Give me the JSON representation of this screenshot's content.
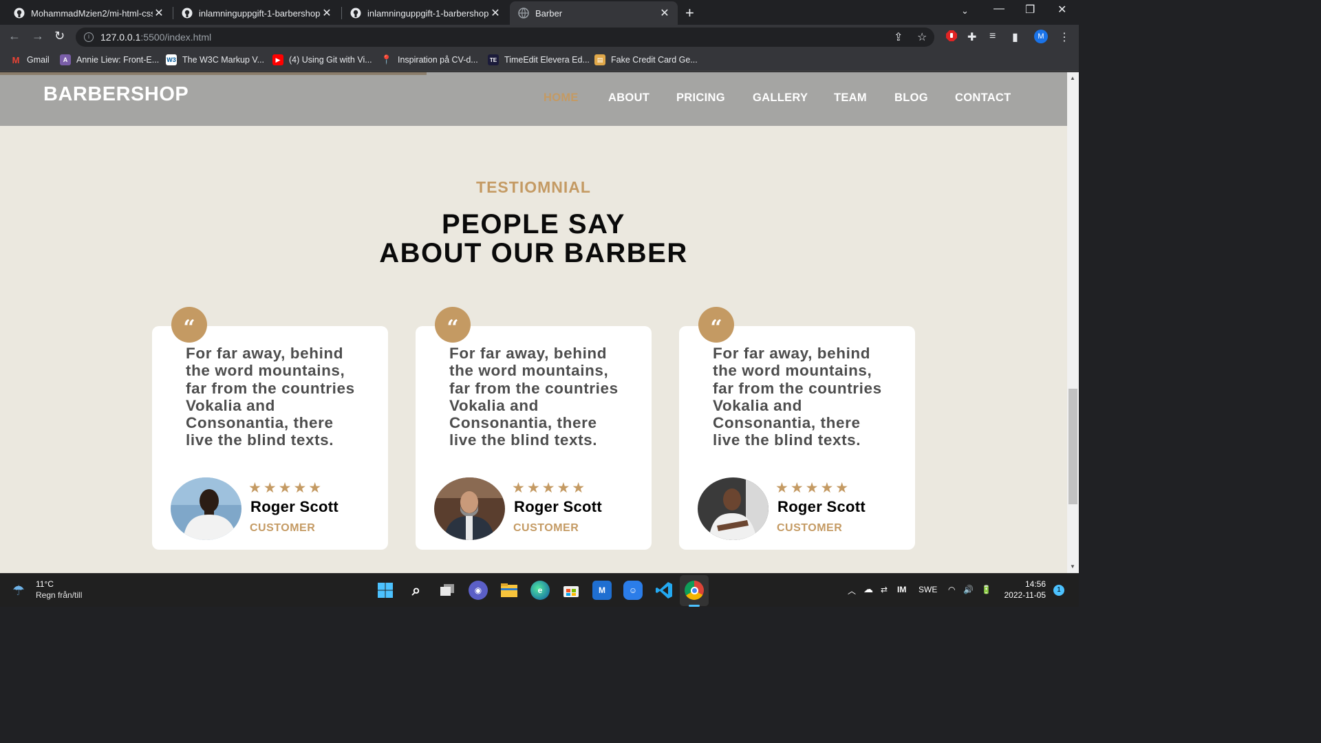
{
  "browser": {
    "tabs": [
      {
        "title": "MohammadMzien2/mi-html-css",
        "active": false
      },
      {
        "title": "inlamninguppgift-1-barbershop-",
        "active": false
      },
      {
        "title": "inlamninguppgift-1-barbershop-",
        "active": false
      },
      {
        "title": "Barber",
        "active": true
      }
    ],
    "url_host": "127.0.0.1",
    "url_path": ":5500/index.html",
    "profile_initial": "M",
    "bookmarks": [
      {
        "label": "Gmail"
      },
      {
        "label": "Annie Liew: Front-E..."
      },
      {
        "label": "The W3C Markup V..."
      },
      {
        "label": "(4) Using Git with Vi..."
      },
      {
        "label": "Inspiration på CV-d..."
      },
      {
        "label": "TimeEdit Elevera Ed..."
      },
      {
        "label": "Fake Credit Card Ge..."
      }
    ]
  },
  "site": {
    "logo": "BARBERSHOP",
    "nav": [
      {
        "label": "HOME",
        "active": true
      },
      {
        "label": "ABOUT",
        "active": false
      },
      {
        "label": "PRICING",
        "active": false
      },
      {
        "label": "GALLERY",
        "active": false
      },
      {
        "label": "TEAM",
        "active": false
      },
      {
        "label": "BLOG",
        "active": false
      },
      {
        "label": "CONTACT",
        "active": false
      }
    ],
    "accent_color": "#c49a63",
    "section_subtitle": "TESTIOMNIAL",
    "section_title_line1": "PEOPLE SAY",
    "section_title_line2": "ABOUT OUR BARBER",
    "testimonials": [
      {
        "text": "For far away, behind the word mountains, far from the countries Vokalia and Consonantia, there live the blind texts.",
        "stars": "★★★★★",
        "rating": 5,
        "name": "Roger Scott",
        "role": "CUSTOMER"
      },
      {
        "text": "For far away, behind the word mountains, far from the countries Vokalia and Consonantia, there live the blind texts.",
        "stars": "★★★★★",
        "rating": 5,
        "name": "Roger Scott",
        "role": "CUSTOMER"
      },
      {
        "text": "For far away, behind the word mountains, far from the countries Vokalia and Consonantia, there live the blind texts.",
        "stars": "★★★★★",
        "rating": 5,
        "name": "Roger Scott",
        "role": "CUSTOMER"
      }
    ]
  },
  "taskbar": {
    "temperature": "11°C",
    "weather": "Regn från/till",
    "language": "SWE",
    "time": "14:56",
    "date": "2022-11-05",
    "notifications": "1"
  }
}
